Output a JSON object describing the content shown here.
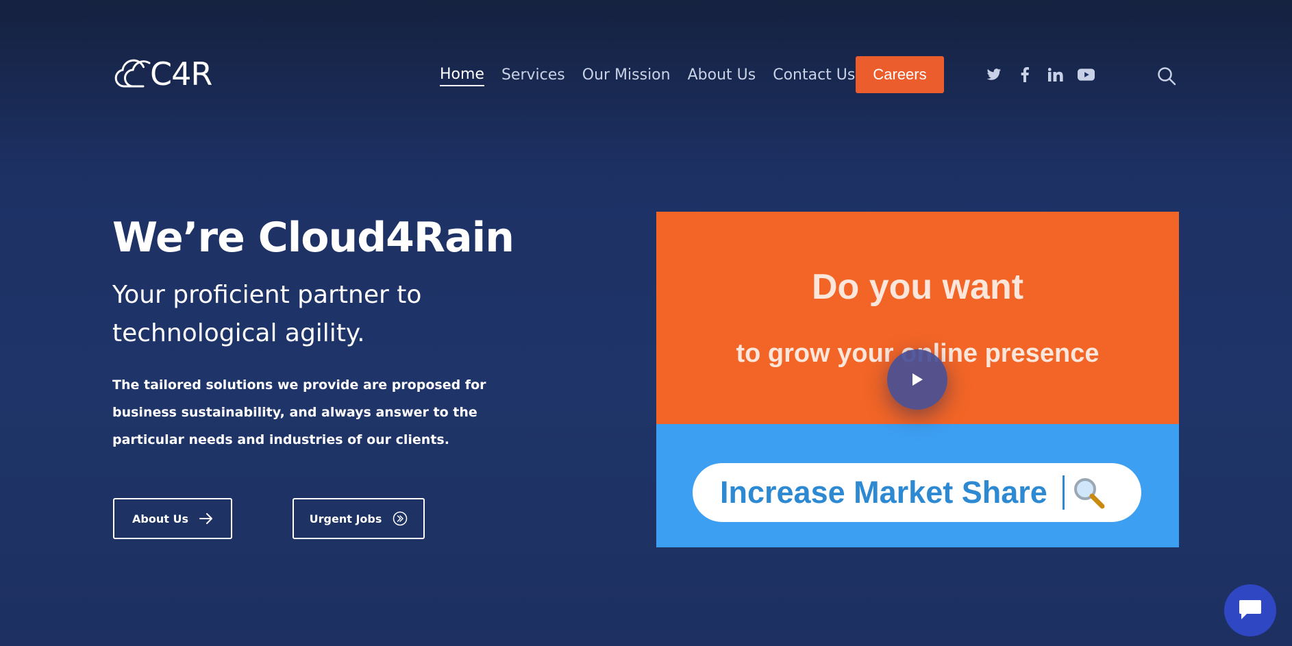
{
  "brand": {
    "logo_text": "C4R"
  },
  "nav": {
    "items": [
      {
        "label": "Home",
        "active": true
      },
      {
        "label": "Services",
        "active": false
      },
      {
        "label": "Our Mission",
        "active": false
      },
      {
        "label": "About Us",
        "active": false
      },
      {
        "label": "Contact Us",
        "active": false
      }
    ],
    "careers_label": "Careers"
  },
  "social": {
    "icons": [
      "twitter-icon",
      "facebook-icon",
      "linkedin-icon",
      "youtube-icon"
    ]
  },
  "search": {
    "icon": "search-icon"
  },
  "hero": {
    "title": "We’re Cloud4Rain",
    "subtitle": "Your proficient partner to technological agility.",
    "body": "The tailored solutions we provide are proposed for business sustainability, and always answer to the particular needs and industries of our clients.",
    "buttons": {
      "about_label": "About Us",
      "jobs_label": "Urgent Jobs"
    }
  },
  "video": {
    "headline": "Do you want",
    "subline": "to grow your online presence",
    "search_text": "Increase Market Share",
    "play_icon": "play-icon"
  },
  "chat": {
    "icon": "chat-icon"
  },
  "colors": {
    "accent": "#ec5d2e",
    "video_orange": "#f26526",
    "video_blue": "#3d9ff2",
    "chat_blue": "#2f47c2"
  }
}
